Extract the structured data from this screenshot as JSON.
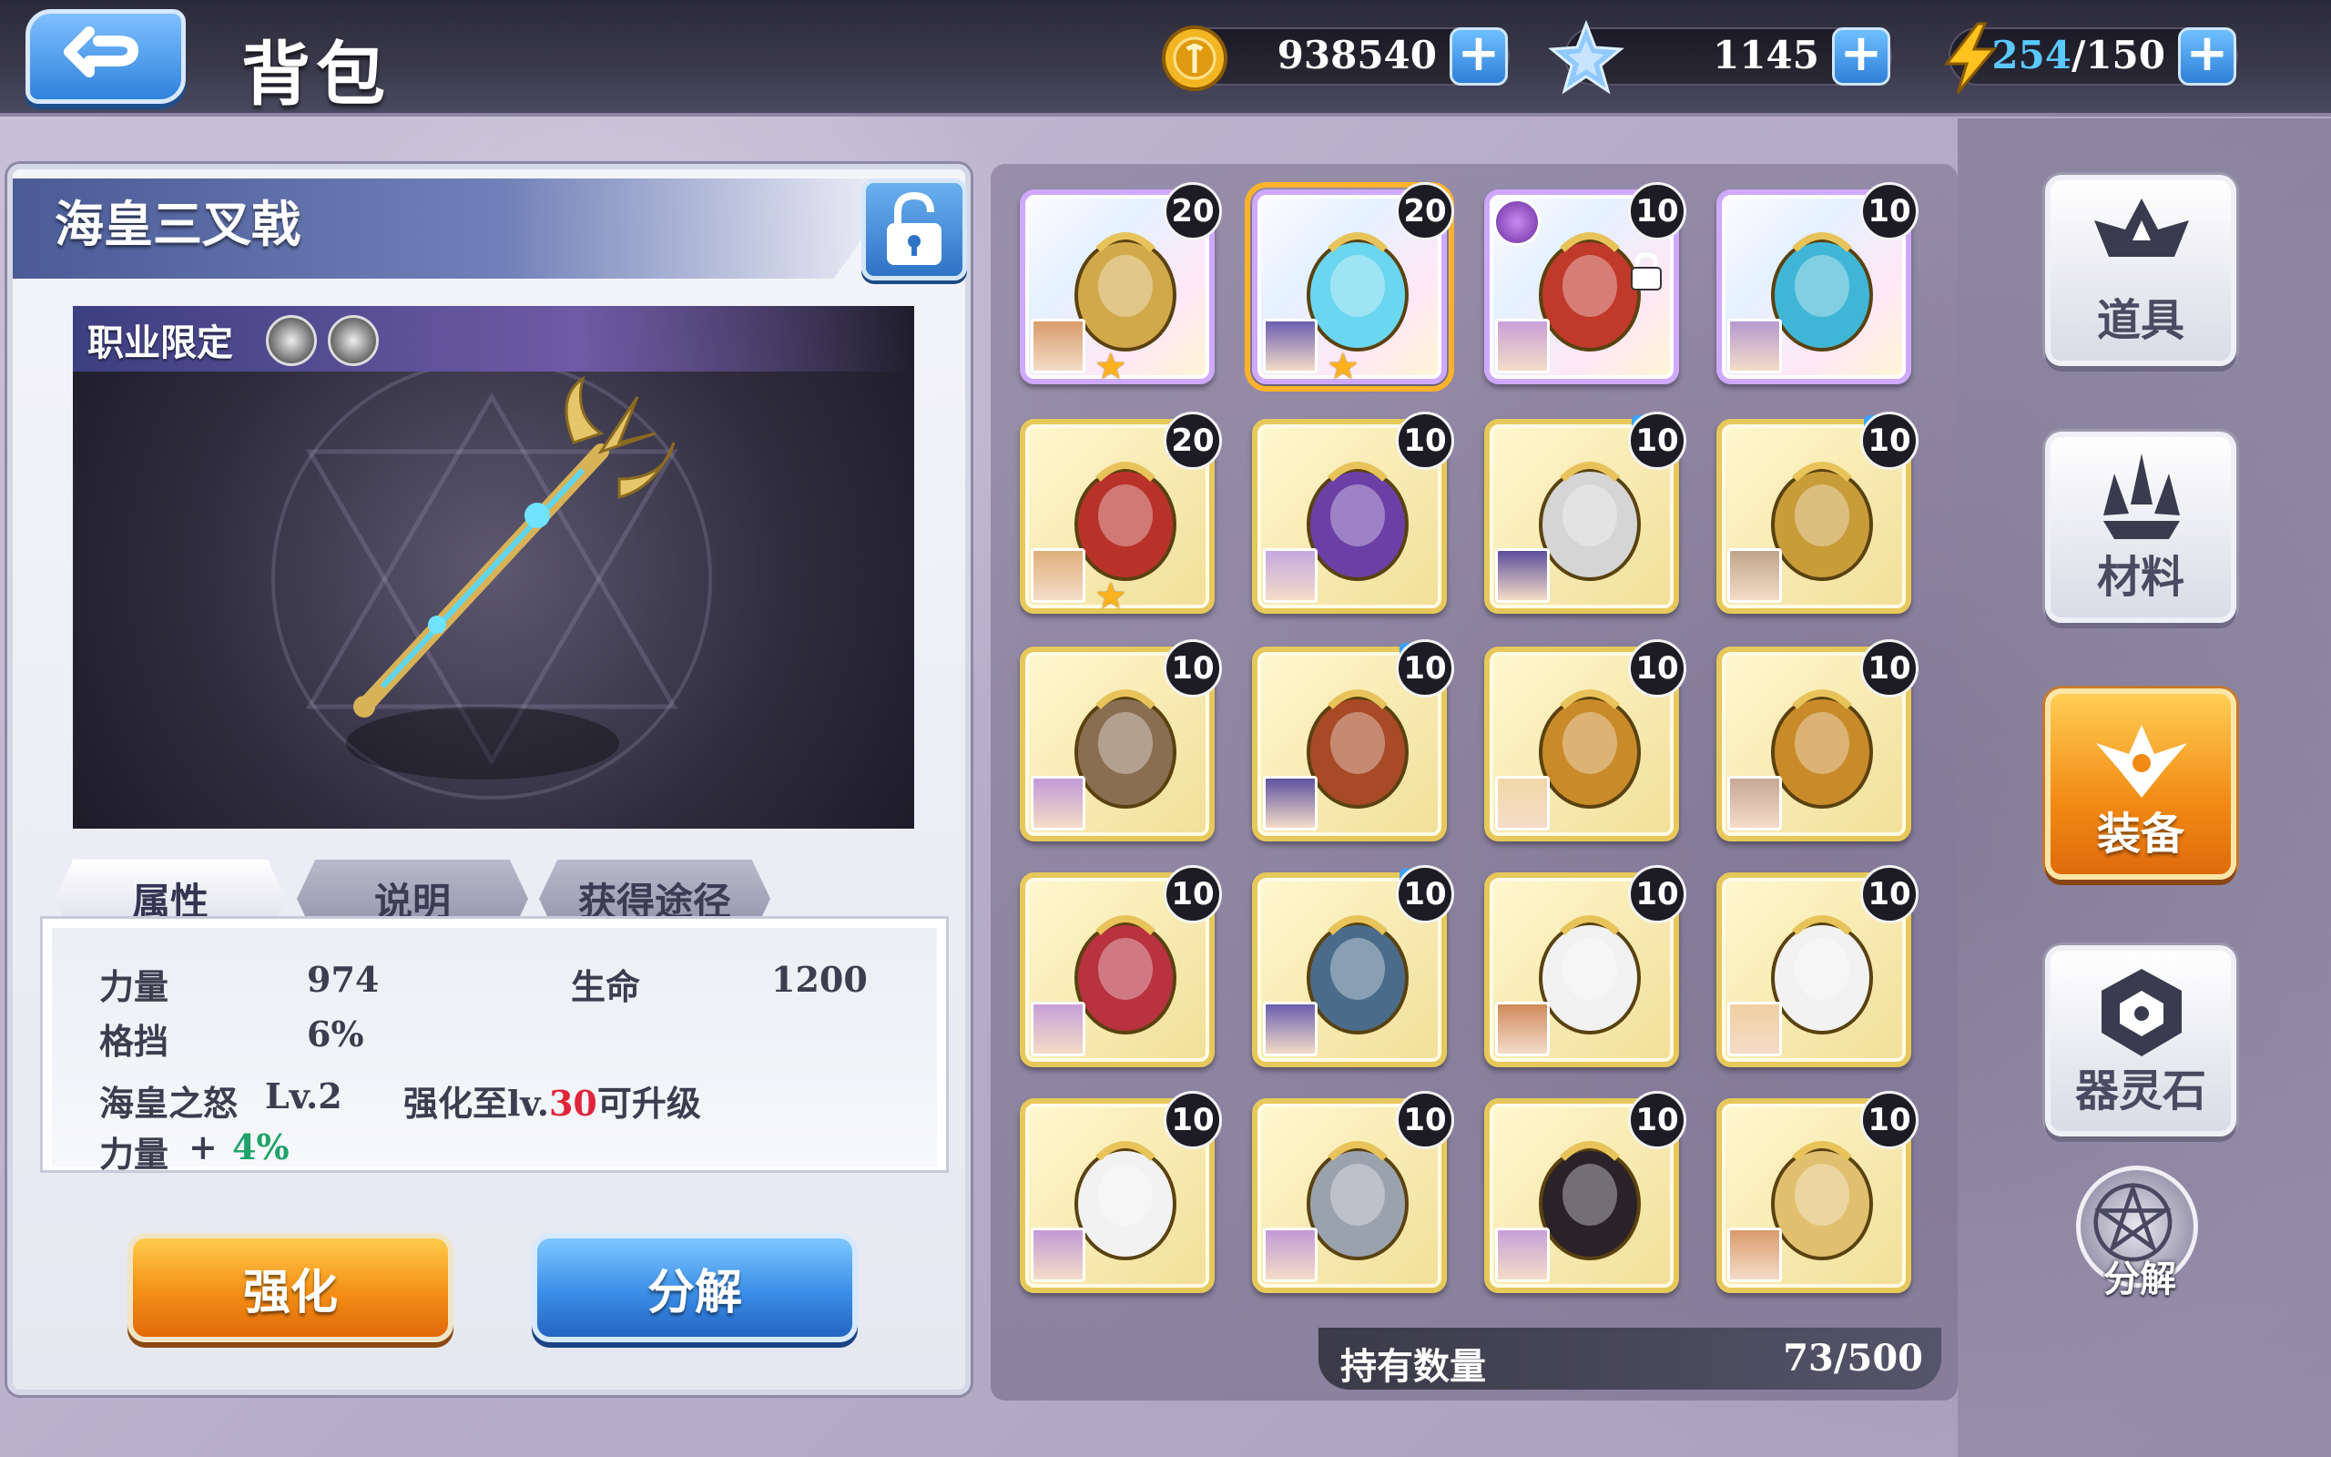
{
  "header": {
    "title": "背包",
    "gold": "938540",
    "stars": "1145",
    "energy_current": "254",
    "energy_max": "/150"
  },
  "item": {
    "name": "海皇三叉戟",
    "class_label": "职业限定"
  },
  "tabs": [
    "属性",
    "说明",
    "获得途径"
  ],
  "stats": {
    "str_label": "力量",
    "str_value": "974",
    "hp_label": "生命",
    "hp_value": "1200",
    "block_label": "格挡",
    "block_value": "6%",
    "skill_name": "海皇之怒",
    "skill_level": "Lv.2",
    "upgrade_prefix": "强化至lv.",
    "upgrade_level": "30",
    "upgrade_suffix": "可升级",
    "bonus_label": "力量",
    "bonus_plus": "+",
    "bonus_value": "4%"
  },
  "buttons": {
    "enhance": "强化",
    "decompose": "分解"
  },
  "grid": {
    "items": [
      {
        "count": "20",
        "rarity": "rainbow",
        "icon": "golden-helmet-icon",
        "star": true,
        "selected": false
      },
      {
        "count": "20",
        "rarity": "rainbow",
        "icon": "trident-icon",
        "star": true,
        "selected": true
      },
      {
        "count": "10",
        "rarity": "rainbow",
        "icon": "flame-sword-icon",
        "star": false,
        "selected": false,
        "locked": true
      },
      {
        "count": "10",
        "rarity": "rainbow",
        "icon": "masquerade-mask-icon",
        "star": false,
        "selected": false
      },
      {
        "count": "20",
        "rarity": "gold",
        "icon": "dragon-shield-icon",
        "star": true,
        "selected": false
      },
      {
        "count": "10",
        "rarity": "gold",
        "icon": "dark-armor-icon",
        "star": false,
        "selected": false
      },
      {
        "count": "10",
        "rarity": "gold",
        "icon": "arrow-icon",
        "star": false,
        "selected": false,
        "new": true
      },
      {
        "count": "10",
        "rarity": "gold",
        "icon": "golden-crown-icon",
        "star": false,
        "selected": false,
        "new": true
      },
      {
        "count": "10",
        "rarity": "gold",
        "icon": "urn-icon",
        "star": false,
        "selected": false
      },
      {
        "count": "10",
        "rarity": "gold",
        "icon": "bronze-helmet-icon",
        "star": false,
        "selected": false,
        "new": true
      },
      {
        "count": "10",
        "rarity": "gold",
        "icon": "plumed-helmet-icon",
        "star": false,
        "selected": false
      },
      {
        "count": "10",
        "rarity": "gold",
        "icon": "plumed-helmet-icon",
        "star": false,
        "selected": false
      },
      {
        "count": "10",
        "rarity": "gold",
        "icon": "dragon-armor-icon",
        "star": false,
        "selected": false
      },
      {
        "count": "10",
        "rarity": "gold",
        "icon": "steel-armor-icon",
        "star": false,
        "selected": false,
        "new": true
      },
      {
        "count": "10",
        "rarity": "gold",
        "icon": "white-robe-icon",
        "star": false,
        "selected": false
      },
      {
        "count": "10",
        "rarity": "gold",
        "icon": "white-robe-icon",
        "star": false,
        "selected": false
      },
      {
        "count": "10",
        "rarity": "gold",
        "icon": "white-robe-icon",
        "star": false,
        "selected": false
      },
      {
        "count": "10",
        "rarity": "gold",
        "icon": "silver-armor-icon",
        "star": false,
        "selected": false
      },
      {
        "count": "10",
        "rarity": "gold",
        "icon": "dark-cloak-icon",
        "star": false,
        "selected": false
      },
      {
        "count": "10",
        "rarity": "gold",
        "icon": "golden-sword-icon",
        "star": false,
        "selected": false
      }
    ]
  },
  "owned": {
    "label": "持有数量",
    "value": "73/500"
  },
  "nav": {
    "items": [
      "道具",
      "材料",
      "装备",
      "器灵石"
    ],
    "active": "装备",
    "decompose": "分解"
  },
  "colors": {
    "accent_orange": "#f48f16",
    "accent_blue": "#2f82dc",
    "stat_green": "#1fa36a",
    "stat_red": "#e0253b"
  }
}
